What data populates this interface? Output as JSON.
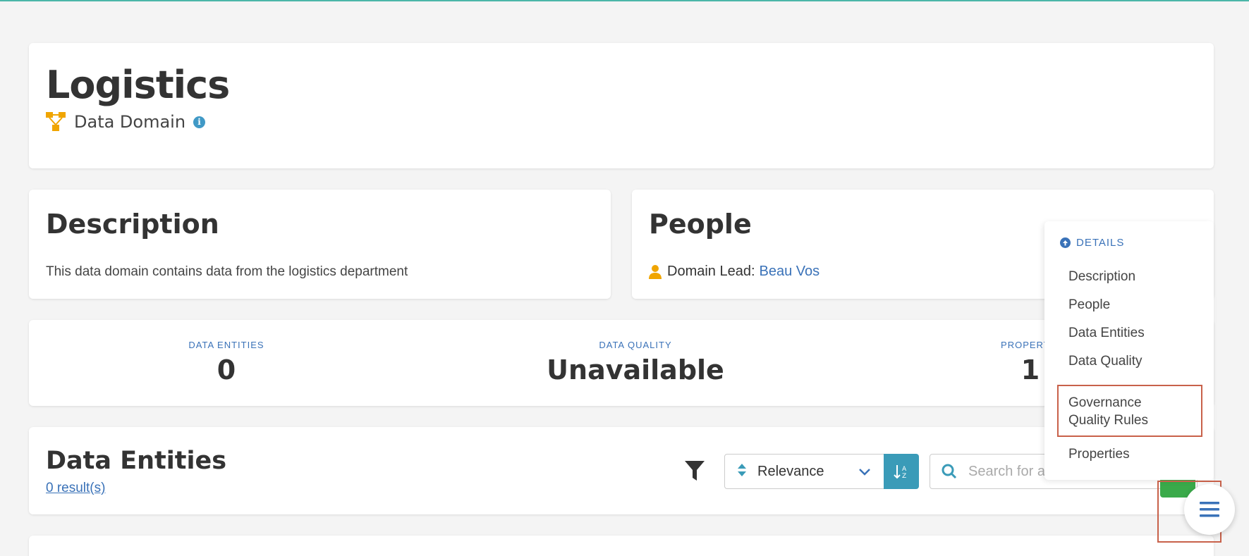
{
  "header": {
    "title": "Logistics",
    "subtitle": "Data Domain"
  },
  "description": {
    "title": "Description",
    "text": "This data domain contains data from the logistics department"
  },
  "people": {
    "title": "People",
    "role_label": "Domain Lead:",
    "lead_name": "Beau Vos"
  },
  "stats": [
    {
      "label": "DATA ENTITIES",
      "value": "0"
    },
    {
      "label": "DATA QUALITY",
      "value": "Unavailable"
    },
    {
      "label": "PROPERTIE",
      "value": "1"
    }
  ],
  "entities": {
    "title": "Data Entities",
    "result_count": "0 result(s)",
    "sort_value": "Relevance",
    "search_placeholder": "Search for ar"
  },
  "toc": {
    "header": "DETAILS",
    "items": [
      "Description",
      "People",
      "Data Entities",
      "Data Quality",
      "Governance Quality Rules",
      "Properties"
    ],
    "selected": "Governance Quality Rules"
  },
  "colors": {
    "accent_blue": "#3a72b8",
    "domain_icon": "#f0a500",
    "sort_button": "#3a9bb8",
    "highlight_border": "#c8614a"
  }
}
